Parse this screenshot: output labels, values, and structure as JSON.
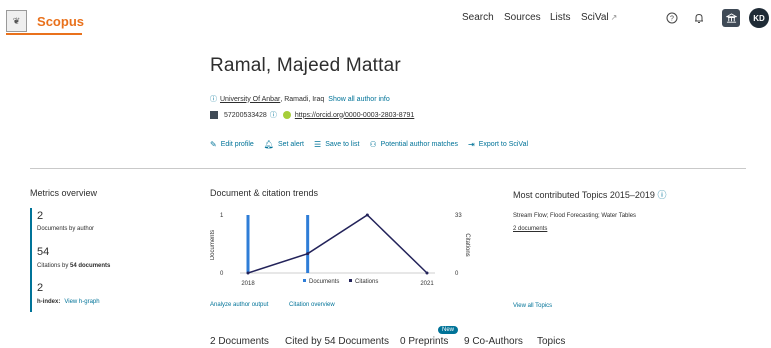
{
  "header": {
    "logo_alt": "Scopus",
    "nav": [
      "Search",
      "Sources",
      "Lists",
      "SciVal"
    ],
    "avatar_initials": "KD"
  },
  "author": {
    "name": "Ramal, Majeed Mattar",
    "affiliation": "University Of Anbar",
    "location": ", Ramadi, Iraq",
    "show_all_label": "Show all author info",
    "scopus_id": "57200533428",
    "orcid": "https://orcid.org/0000-0003-2803-8791"
  },
  "actions": [
    {
      "label": "Edit profile",
      "icon": "pencil-icon"
    },
    {
      "label": "Set alert",
      "icon": "bell-icon"
    },
    {
      "label": "Save to list",
      "icon": "list-icon"
    },
    {
      "label": "Potential author matches",
      "icon": "people-icon"
    },
    {
      "label": "Export to SciVal",
      "icon": "export-icon"
    }
  ],
  "metrics": {
    "title": "Metrics overview",
    "documents_value": "2",
    "documents_label": "Documents by author",
    "citations_value": "54",
    "citations_label_prefix": "Citations by ",
    "citations_label_bold": "54 documents",
    "hindex_value": "2",
    "hindex_label": "h-index:",
    "hindex_link": "View h-graph"
  },
  "trends": {
    "title": "Document & citation trends",
    "analyze_link": "Analyze author output",
    "citation_link": "Citation overview"
  },
  "chart_data": {
    "type": "bar",
    "x": [
      2018,
      2019,
      2020,
      2021
    ],
    "xlim": [
      2018,
      2021
    ],
    "series": [
      {
        "name": "Documents",
        "type": "bar",
        "axis": "left",
        "values": [
          1,
          1,
          0,
          0
        ],
        "color": "#2e7dd7"
      },
      {
        "name": "Citations",
        "type": "line",
        "axis": "right",
        "values": [
          0,
          11,
          33,
          0
        ],
        "color": "#23235a"
      }
    ],
    "ylabel_left": "Documents",
    "ylabel_right": "Citations",
    "yticks_left": [
      "1",
      "0"
    ],
    "yticks_right": [
      "33",
      "0"
    ],
    "ylim_left": [
      0,
      1
    ],
    "ylim_right": [
      0,
      33
    ],
    "xticks": [
      "2018",
      "2021"
    ],
    "legend_position": "bottom"
  },
  "topics": {
    "title": "Most contributed Topics 2015–2019",
    "topic": "Stream Flow; Flood Forecasting; Water Tables",
    "docs": "2 documents",
    "view_all": "View all Topics"
  },
  "tabs": [
    "2 Documents",
    "Cited by 54 Documents",
    "0 Preprints",
    "9 Co-Authors",
    "Topics"
  ],
  "new_badge": "New",
  "colors": {
    "brand": "#e9711c",
    "link": "#007398",
    "bar": "#2e7dd7",
    "line": "#23235a"
  }
}
